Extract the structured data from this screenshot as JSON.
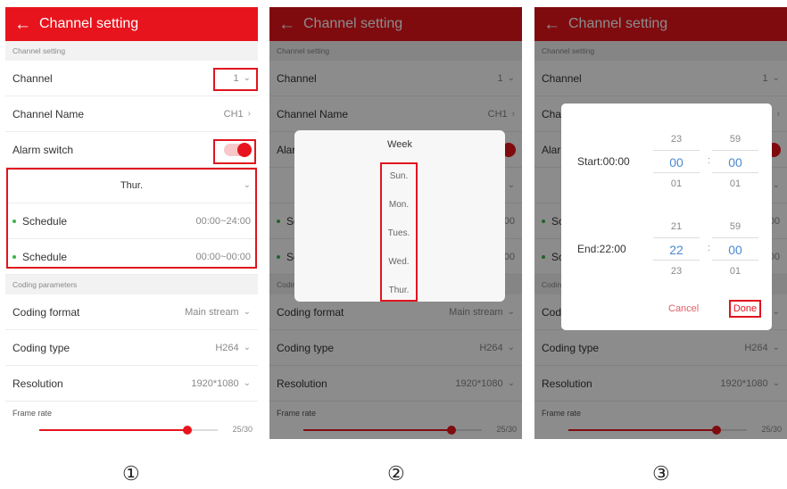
{
  "appbar": {
    "back_glyph": "←",
    "title": "Channel setting"
  },
  "sections": {
    "channel": "Channel setting",
    "coding": "Coding parameters"
  },
  "channel_row": {
    "label": "Channel",
    "value": "1"
  },
  "channel_name_row": {
    "label": "Channel Name",
    "value": "CH1"
  },
  "alarm_row": {
    "label": "Alarm switch"
  },
  "day_row": {
    "value": "Thur."
  },
  "schedules": [
    {
      "label": "Schedule",
      "value": "00:00~24:00"
    },
    {
      "label": "Schedule",
      "value": "00:00~00:00"
    }
  ],
  "coding_format": {
    "label": "Coding format",
    "value": "Main stream"
  },
  "coding_type": {
    "label": "Coding type",
    "value": "H264"
  },
  "resolution": {
    "label": "Resolution",
    "value": "1920*1080"
  },
  "frame_rate": {
    "label": "Frame rate",
    "value": "25/30"
  },
  "week_dialog": {
    "title": "Week",
    "items": [
      "Sun.",
      "Mon.",
      "Tues.",
      "Wed.",
      "Thur."
    ]
  },
  "time_dialog": {
    "start": {
      "label": "Start:00:00",
      "hour": [
        "23",
        "00",
        "01"
      ],
      "minute": [
        "59",
        "00",
        "01"
      ]
    },
    "end": {
      "label": "End:22:00",
      "hour": [
        "21",
        "22",
        "23"
      ],
      "minute": [
        "59",
        "00",
        "01"
      ]
    },
    "cancel": "Cancel",
    "done": "Done"
  },
  "step_numbers": [
    "①",
    "②",
    "③"
  ],
  "colors": {
    "accent": "#e8141d",
    "highlight": "#4a8ad0",
    "schedule_dot": "#3cb44a"
  }
}
